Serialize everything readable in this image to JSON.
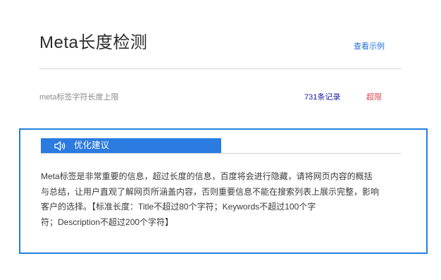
{
  "header": {
    "title": "Meta长度检测",
    "examples_link": "查看示例"
  },
  "result_row": {
    "label": "meta标签字符长度上限",
    "count": "731条记录",
    "status": "超限",
    "status_color": "#e0434a"
  },
  "advice": {
    "tab_label": "优化建议",
    "tab_icon": "speaker-icon",
    "accent_color": "#1f7fe0",
    "lines": [
      "Meta标签是非常重要的信息，超过长度的信息，百度将会进行隐藏，请将网页内容的概括",
      "与总结，让用户直观了解网页所涵盖内容，否则重要信息不能在搜索列表上展示完整，影响",
      "客户的选择。【标准长度：Title不超过80个字符；Keywords不超过100个字",
      "符；Description不超过200个字符】"
    ]
  }
}
